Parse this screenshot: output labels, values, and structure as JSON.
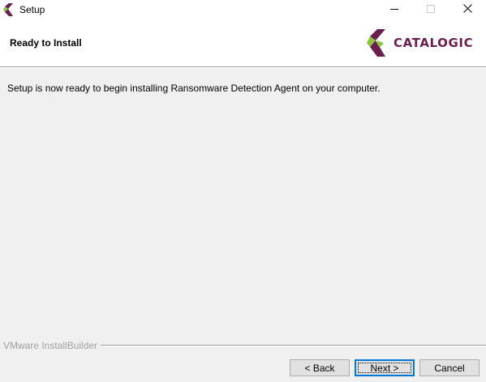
{
  "window": {
    "title": "Setup",
    "app_icon": "catalogic-logo-icon",
    "controls": {
      "minimize_icon": "minimize-icon",
      "maximize_icon": "maximize-icon",
      "close_icon": "close-icon"
    }
  },
  "header": {
    "title": "Ready to Install",
    "logo_text": "CATALOGIC"
  },
  "main": {
    "message": "Setup is now ready to begin installing Ransomware Detection Agent on your computer."
  },
  "footer": {
    "branding": "VMware InstallBuilder",
    "back_label": "< Back",
    "next_label": "Next >",
    "cancel_label": "Cancel"
  },
  "colors": {
    "brand_purple": "#6b1f4f",
    "brand_green": "#8cc63f",
    "window_bg": "#f0f0f0",
    "focus_blue": "#0078d7"
  }
}
